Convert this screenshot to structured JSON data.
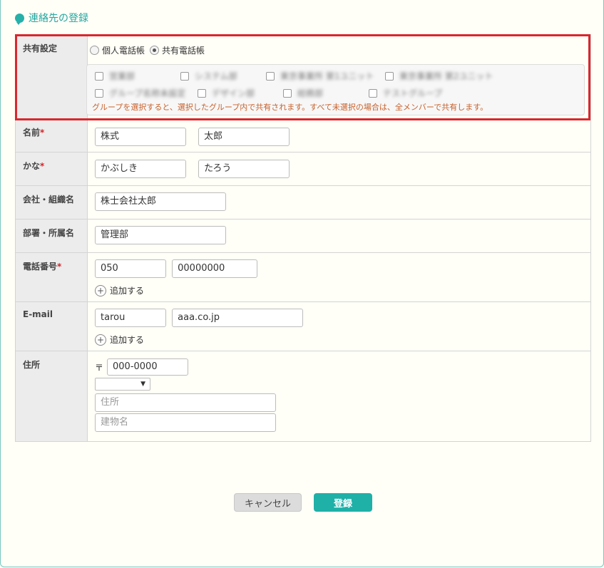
{
  "page": {
    "title": "連絡先の登録"
  },
  "share": {
    "label": "共有設定",
    "options": [
      "個人電話帳",
      "共有電話帳"
    ],
    "selected": "共有電話帳",
    "groups": [
      "営業部",
      "システム部",
      "東京事業所 第1ユニット",
      "東京事業所 第2ユニット",
      "グループ名称未設定",
      "デザイン部",
      "総務部",
      "テストグループ"
    ],
    "note": "グループを選択すると、選択したグループ内で共有されます。すべて未選択の場合は、全メンバーで共有します。"
  },
  "name": {
    "label": "名前",
    "required_mark": "*",
    "last": "株式",
    "first": "太郎"
  },
  "kana": {
    "label": "かな",
    "required_mark": "*",
    "last": "かぶしき",
    "first": "たろう"
  },
  "company": {
    "label": "会社・組織名",
    "value": "株士会社太郎"
  },
  "dept": {
    "label": "部署・所属名",
    "value": "管理部"
  },
  "tel": {
    "label": "電話番号",
    "required_mark": "*",
    "part1": "050",
    "part2": "00000000",
    "add_label": "追加する"
  },
  "email": {
    "label": "E-mail",
    "local": "tarou",
    "domain": "aaa.co.jp",
    "add_label": "追加する"
  },
  "address": {
    "label": "住所",
    "postal_mark": "〒",
    "postal": "000-0000",
    "prefecture_selected": "",
    "address_placeholder": "住所",
    "building_placeholder": "建物名"
  },
  "buttons": {
    "cancel": "キャンセル",
    "submit": "登録"
  },
  "colors": {
    "accent": "#1fb0a8",
    "highlight": "#d9272e",
    "note": "#c8612b",
    "required": "#d0262c"
  }
}
